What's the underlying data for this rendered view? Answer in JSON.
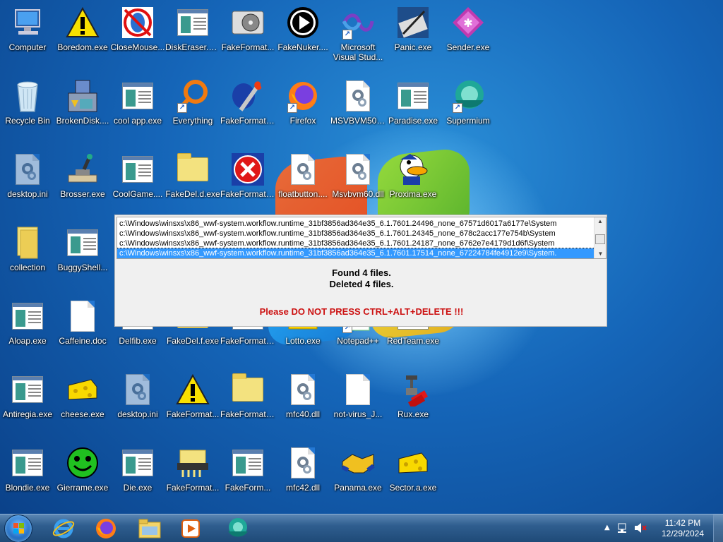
{
  "desktop": {
    "icons": [
      {
        "label": "Computer"
      },
      {
        "label": "Boredom.exe"
      },
      {
        "label": "CloseMouse..."
      },
      {
        "label": "DiskEraser.exe"
      },
      {
        "label": "FakeFormat..."
      },
      {
        "label": "FakeNuker...."
      },
      {
        "label": "Microsoft Visual Stud..."
      },
      {
        "label": "Panic.exe"
      },
      {
        "label": "Sender.exe"
      },
      {
        "label": "Recycle Bin"
      },
      {
        "label": "BrokenDisk...."
      },
      {
        "label": "cool app.exe"
      },
      {
        "label": "Everything"
      },
      {
        "label": "FakeFormat...."
      },
      {
        "label": "Firefox"
      },
      {
        "label": "MSVBVM50...."
      },
      {
        "label": "Paradise.exe"
      },
      {
        "label": "Supermium"
      },
      {
        "label": "desktop.ini"
      },
      {
        "label": "Brosser.exe"
      },
      {
        "label": "CoolGame...."
      },
      {
        "label": "FakeDel.d.exe"
      },
      {
        "label": "FakeFormat...."
      },
      {
        "label": "floatbutton...."
      },
      {
        "label": "Msvbvm60.dll"
      },
      {
        "label": "Proxima.exe"
      },
      {
        "label": "collection"
      },
      {
        "label": "BuggyShell..."
      },
      {
        "label": "Aloap.exe"
      },
      {
        "label": "Caffeine.doc"
      },
      {
        "label": "Delfib.exe"
      },
      {
        "label": "FakeDel.f.exe"
      },
      {
        "label": "FakeFormat...."
      },
      {
        "label": "Lotto.exe"
      },
      {
        "label": "Notepad++"
      },
      {
        "label": "RedTeam.exe"
      },
      {
        "label": "Antiregia.exe"
      },
      {
        "label": "cheese.exe"
      },
      {
        "label": "desktop.ini"
      },
      {
        "label": "FakeFormat..."
      },
      {
        "label": "FakeFormat...."
      },
      {
        "label": "mfc40.dll"
      },
      {
        "label": "not-virus_J..."
      },
      {
        "label": "Rux.exe"
      },
      {
        "label": "Blondie.exe"
      },
      {
        "label": "Gierrame.exe"
      },
      {
        "label": "Die.exe"
      },
      {
        "label": "FakeFormat..."
      },
      {
        "label": "FakeForm..."
      },
      {
        "label": "mfc42.dll"
      },
      {
        "label": "Panama.exe"
      },
      {
        "label": "Sector.a.exe"
      }
    ]
  },
  "dialog": {
    "files": [
      "c:\\Windows\\winsxs\\x86_wwf-system.workflow.runtime_31bf3856ad364e35_6.1.7601.24496_none_67571d6017a6177e\\System",
      "c:\\Windows\\winsxs\\x86_wwf-system.workflow.runtime_31bf3856ad364e35_6.1.7601.24345_none_678c2acc177e754b\\System",
      "c:\\Windows\\winsxs\\x86_wwf-system.workflow.runtime_31bf3856ad364e35_6.1.7601.24187_none_6762e7e4179d1d6f\\System",
      "c:\\Windows\\winsxs\\x86_wwf-system.workflow.runtime_31bf3856ad364e35_6.1.7601.17514_none_67224784fe4912e9\\System."
    ],
    "found_text": "Found 4 files.",
    "deleted_text": "Deleted 4 files.",
    "warning_text": "Please DO NOT PRESS CTRL+ALT+DELETE !!!",
    "warning_color": "#cc1111"
  },
  "taskbar": {
    "apps": [
      "internet-explorer-icon",
      "firefox-icon",
      "file-explorer-icon",
      "media-player-icon",
      "supermium-icon"
    ],
    "time": "11:42 PM",
    "date": "12/29/2024"
  }
}
